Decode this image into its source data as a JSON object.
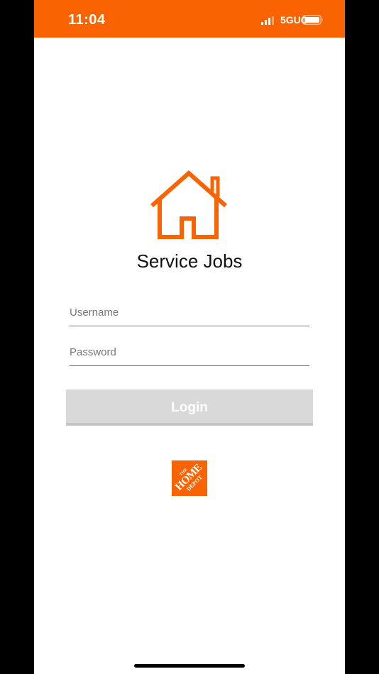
{
  "status_bar": {
    "time": "11:04",
    "network": "5GUC",
    "signal_icon": "signal-bars-icon",
    "battery_icon": "battery-icon",
    "background_color": "#f96302"
  },
  "app": {
    "icon": "house-icon",
    "title": "Service Jobs",
    "accent_color": "#f96302"
  },
  "form": {
    "username_placeholder": "Username",
    "password_placeholder": "Password",
    "login_label": "Login"
  },
  "brand": {
    "logo": "home-depot-logo",
    "logo_text": [
      "THE",
      "HOME",
      "DEPOT"
    ]
  }
}
